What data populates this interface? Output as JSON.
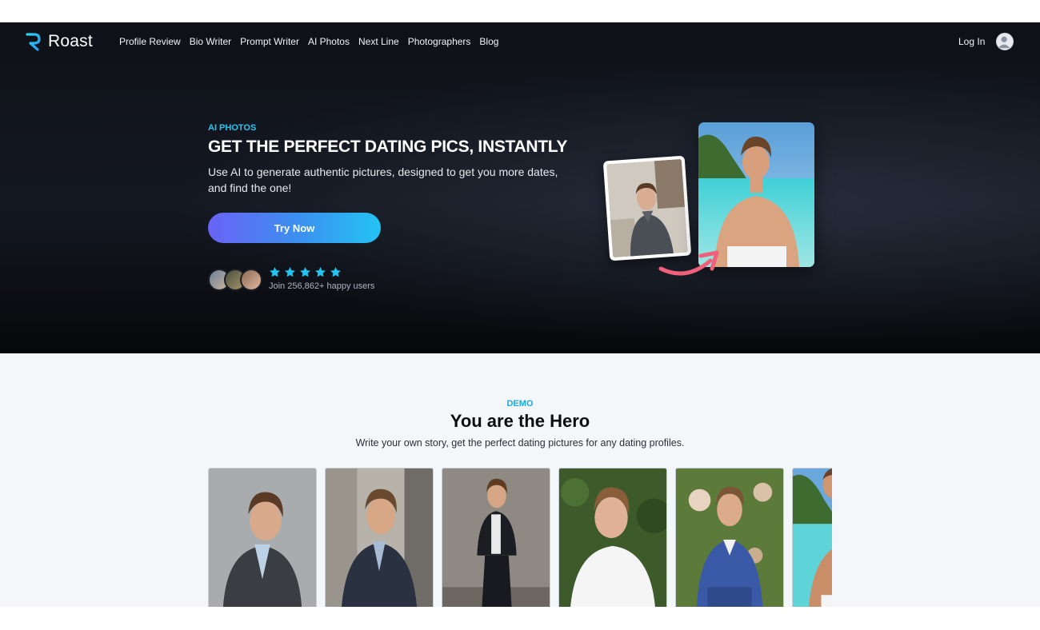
{
  "brand": {
    "name": "Roast"
  },
  "nav": {
    "links": [
      "Profile Review",
      "Bio Writer",
      "Prompt Writer",
      "AI Photos",
      "Next Line",
      "Photographers",
      "Blog"
    ],
    "login": "Log In"
  },
  "hero": {
    "eyebrow": "AI PHOTOS",
    "headline": "GET THE PERFECT DATING PICS, INSTANTLY",
    "subtext": "Use AI to generate authentic pictures, designed to get you more dates, and find the one!",
    "cta": "Try Now",
    "rating_stars": 5,
    "social_proof": "Join 256,862+ happy users"
  },
  "demo": {
    "eyebrow": "DEMO",
    "title": "You are the Hero",
    "subtitle": "Write your own story, get the perfect dating pictures for any dating profiles."
  },
  "colors": {
    "accent": "#28c4f2",
    "cta_gradient_start": "#6a63f5",
    "cta_gradient_end": "#23c3f3",
    "arrow": "#f0607a"
  },
  "icons": [
    "logo-icon",
    "user-avatar-icon",
    "star-icon",
    "curved-arrow-icon"
  ]
}
